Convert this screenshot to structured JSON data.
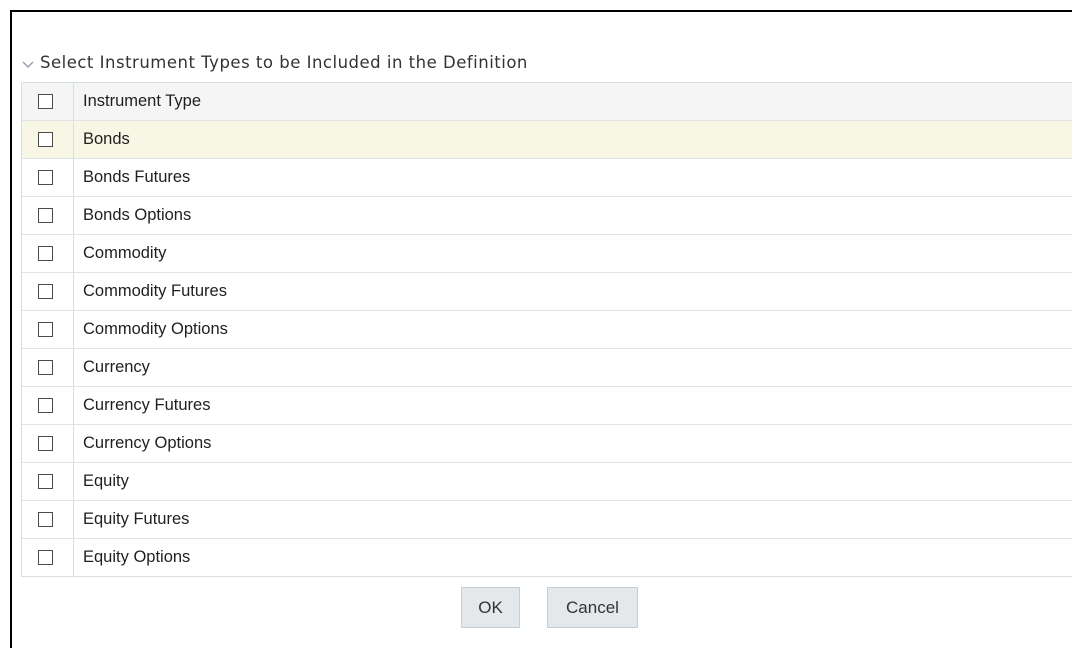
{
  "section": {
    "title": "Select Instrument Types to be Included in the Definition",
    "icon": "chevron-down-icon"
  },
  "table": {
    "header": {
      "column_label": "Instrument Type",
      "select_all_checked": false
    },
    "rows": [
      {
        "label": "Bonds",
        "checked": false,
        "highlighted": true
      },
      {
        "label": "Bonds Futures",
        "checked": false,
        "highlighted": false
      },
      {
        "label": "Bonds Options",
        "checked": false,
        "highlighted": false
      },
      {
        "label": "Commodity",
        "checked": false,
        "highlighted": false
      },
      {
        "label": "Commodity Futures",
        "checked": false,
        "highlighted": false
      },
      {
        "label": "Commodity Options",
        "checked": false,
        "highlighted": false
      },
      {
        "label": "Currency",
        "checked": false,
        "highlighted": false
      },
      {
        "label": "Currency Futures",
        "checked": false,
        "highlighted": false
      },
      {
        "label": "Currency Options",
        "checked": false,
        "highlighted": false
      },
      {
        "label": "Equity",
        "checked": false,
        "highlighted": false
      },
      {
        "label": "Equity Futures",
        "checked": false,
        "highlighted": false
      },
      {
        "label": "Equity Options",
        "checked": false,
        "highlighted": false
      }
    ]
  },
  "buttons": {
    "ok_label": "OK",
    "cancel_label": "Cancel"
  },
  "colors": {
    "highlight_row": "#f8f7e6",
    "header_row": "#f5f5f5",
    "button_bg": "#e4e8ea",
    "grid_border": "#d6dfe6"
  }
}
